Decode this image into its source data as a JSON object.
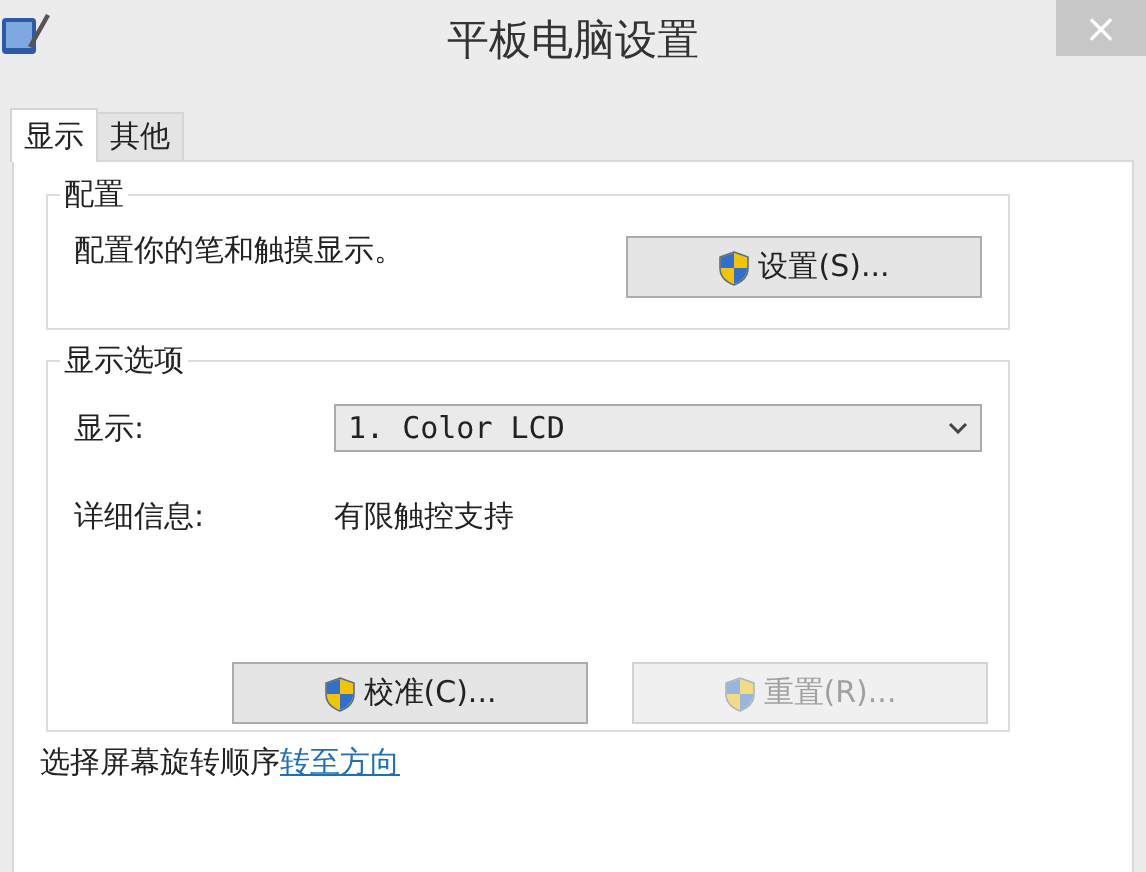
{
  "window": {
    "title": "平板电脑设置",
    "close": "×"
  },
  "tabs": [
    {
      "label": "显示",
      "selected": true
    },
    {
      "label": "其他",
      "selected": false
    }
  ],
  "config_group": {
    "title": "配置",
    "description": "配置你的笔和触摸显示。",
    "button": {
      "label": "设置(S)...",
      "disabled": false
    }
  },
  "display_group": {
    "title": "显示选项",
    "display_label": "显示:",
    "display_value": "1. Color LCD",
    "details_label": "详细信息:",
    "details_value": "有限触控支持",
    "buttons": [
      {
        "label": "校准(C)...",
        "disabled": false
      },
      {
        "label": "重置(R)...",
        "disabled": true
      }
    ]
  },
  "rotation": {
    "text": "选择屏幕旋转顺序",
    "link": "转至方向"
  }
}
